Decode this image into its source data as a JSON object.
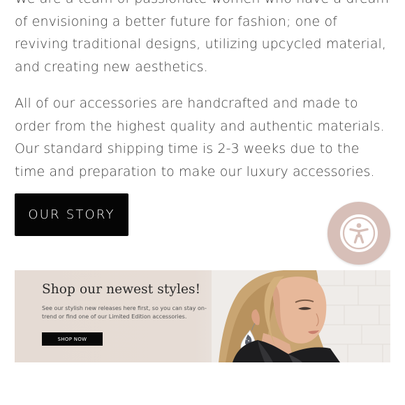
{
  "about": {
    "paragraph_1": "We are a team of passionate women who have a dream of envisioning a better future for fashion; one of reviving traditional designs, utilizing upcycled material, and creating new aesthetics.",
    "paragraph_2": "All of our accessories are handcrafted and made to order from the highest quality and authentic materials. Our standard shipping time is 2-3 weeks due to the time and preparation to make our luxury accessories.",
    "cta_label": "OUR STORY"
  },
  "accessibility_widget": {
    "icon": "accessibility-person-icon",
    "color": "#d7bfb8"
  },
  "banner": {
    "title": "Shop our newest styles!",
    "subtitle": "See our stylish new releases here first, so you can stay on-trend or find one of our Limited Edition accessories.",
    "button_label": "SHOP NOW",
    "photo": "woman-wearing-teardrop-earring-photo"
  }
}
